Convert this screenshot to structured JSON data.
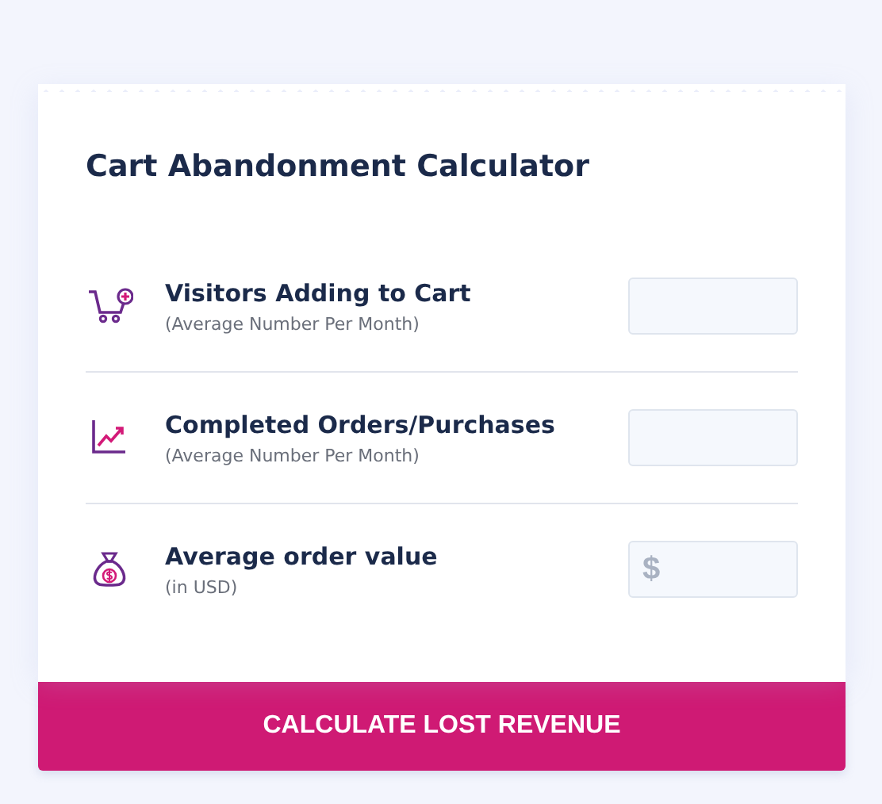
{
  "title": "Cart Abandonment Calculator",
  "fields": [
    {
      "kind": "cart",
      "label": "Visitors Adding to Cart",
      "hint": "(Average Number Per Month)"
    },
    {
      "kind": "chart",
      "label": "Completed Orders/Purchases",
      "hint": "(Average Number Per Month)"
    },
    {
      "kind": "money",
      "label": "Average order value",
      "hint": "(in USD)",
      "placeholder": "$"
    }
  ],
  "button": "CALCULATE LOST REVENUE"
}
